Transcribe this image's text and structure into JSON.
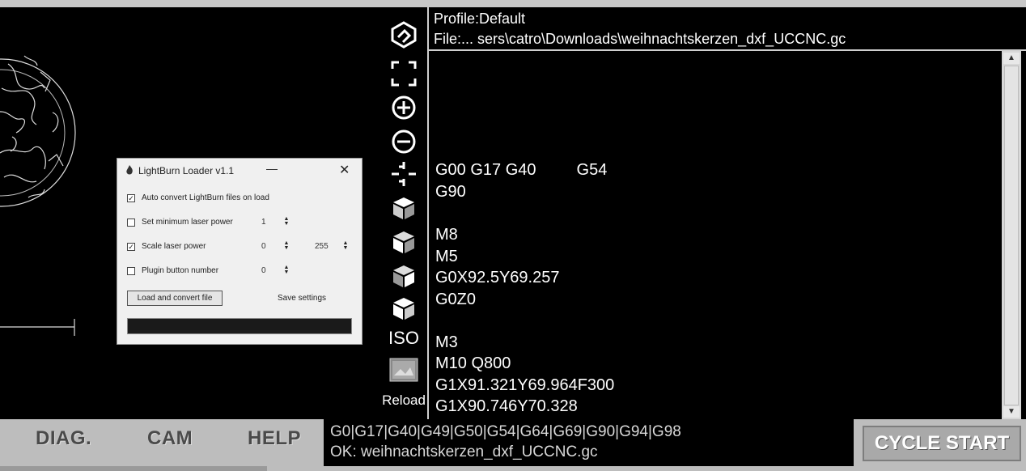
{
  "header": {
    "profile": "Profile:Default",
    "file": "File:... sers\\catro\\Downloads\\weihnachtskerzen_dxf_UCCNC.gc"
  },
  "toolbar": {
    "iso_label": "ISO",
    "reload_label": "Reload",
    "icons": [
      "logo-icon",
      "fit-screen-icon",
      "zoom-in-icon",
      "zoom-out-icon",
      "center-icon",
      "view-cube-icon",
      "view-cube-icon",
      "view-cube-icon",
      "view-cube-icon",
      "image-icon"
    ]
  },
  "gcode": {
    "lines": [
      "G00 G17 G40         G54",
      "G90",
      "",
      "M8",
      "M5",
      "G0X92.5Y69.257",
      "G0Z0",
      "",
      "M3",
      "M10 Q800",
      "G1X91.321Y69.964F300",
      "G1X90.746Y70.328"
    ]
  },
  "bottom": {
    "tabs": [
      "DIAG.",
      "CAM",
      "HELP"
    ],
    "status_modes": "G0|G17|G40|G49|G50|G54|G64|G69|G90|G94|G98",
    "status_message": "OK: weihnachtskerzen_dxf_UCCNC.gc",
    "cycle_start": "CYCLE START"
  },
  "dialog": {
    "title": "LightBurn Loader v1.1",
    "auto_convert": {
      "label": "Auto convert LightBurn files on load",
      "checked": true
    },
    "min_power": {
      "label": "Set minimum laser power",
      "checked": false,
      "value": "1"
    },
    "scale_power": {
      "label": "Scale laser power",
      "checked": true,
      "min": "0",
      "max": "255"
    },
    "plugin_button": {
      "label": "Plugin button number",
      "checked": false,
      "value": "0"
    },
    "load_button": "Load and convert file",
    "save_settings": "Save settings",
    "minimize_glyph": "—",
    "close_glyph": "✕"
  },
  "colors": {
    "background": "#000000",
    "panel": "#bdbdbd",
    "text": "#ffffff"
  }
}
